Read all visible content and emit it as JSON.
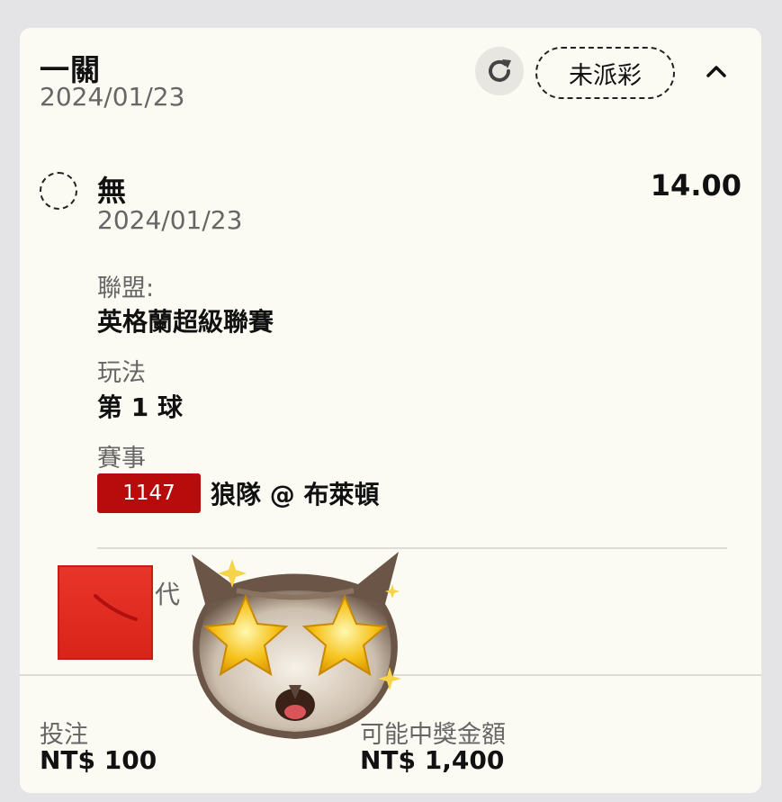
{
  "bet": {
    "type_title": "一關",
    "date": "2024/01/23",
    "status": "未派彩",
    "icons": {
      "refresh": "refresh-icon",
      "collapse": "chevron-up-icon"
    }
  },
  "selection": {
    "name": "無",
    "date": "2024/01/23",
    "odds": "14.00",
    "league_label": "聯盟:",
    "league": "英格蘭超級聯賽",
    "market_label": "玩法",
    "market": "第 1 球",
    "event_label": "賽事",
    "event_id": "1147",
    "event_name": "狼隊 @ 布萊頓",
    "partial_label": "代"
  },
  "footer": {
    "stake_label": "投注",
    "stake": "NT$ 100",
    "payout_label": "可能中獎金額",
    "payout": "NT$ 1,400"
  },
  "colors": {
    "card_bg": "#fcfbf3",
    "page_bg": "#e4e4e7",
    "event_badge": "#b80b0b",
    "red_block": "#e02a20"
  }
}
